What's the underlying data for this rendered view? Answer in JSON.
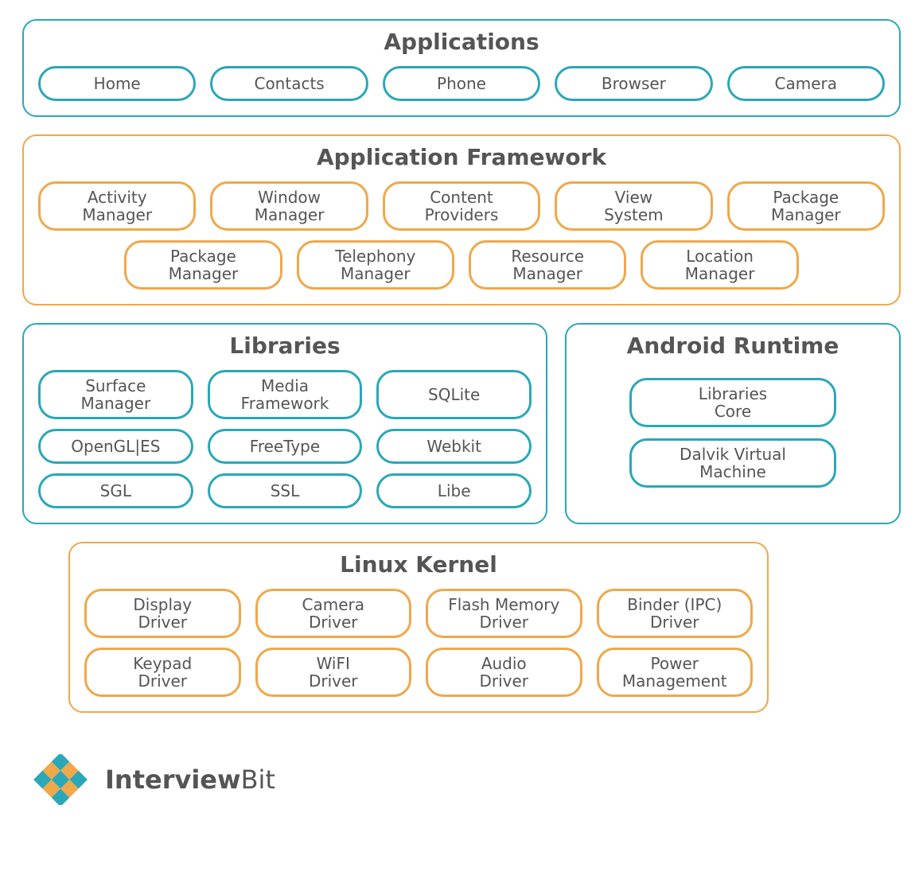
{
  "applications": {
    "title": "Applications",
    "items": [
      "Home",
      "Contacts",
      "Phone",
      "Browser",
      "Camera"
    ]
  },
  "framework": {
    "title": "Application Framework",
    "row1": [
      "Activity\nManager",
      "Window\nManager",
      "Content\nProviders",
      "View\nSystem",
      "Package\nManager"
    ],
    "row2": [
      "Package\nManager",
      "Telephony\nManager",
      "Resource\nManager",
      "Location\nManager"
    ]
  },
  "libraries": {
    "title": "Libraries",
    "row1": [
      "Surface\nManager",
      "Media\nFramework",
      "SQLite"
    ],
    "row2": [
      "OpenGL|ES",
      "FreeType",
      "Webkit"
    ],
    "row3": [
      "SGL",
      "SSL",
      "Libe"
    ]
  },
  "runtime": {
    "title": "Android Runtime",
    "items": [
      "Libraries\nCore",
      "Dalvik Virtual\nMachine"
    ]
  },
  "kernel": {
    "title": "Linux Kernel",
    "row1": [
      "Display\nDriver",
      "Camera\nDriver",
      "Flash Memory\nDriver",
      "Binder (IPC)\nDriver"
    ],
    "row2": [
      "Keypad\nDriver",
      "WiFI\nDriver",
      "Audio\nDriver",
      "Power\nManagement"
    ]
  },
  "brand": {
    "name_bold": "Interview",
    "name_light": "Bit"
  }
}
